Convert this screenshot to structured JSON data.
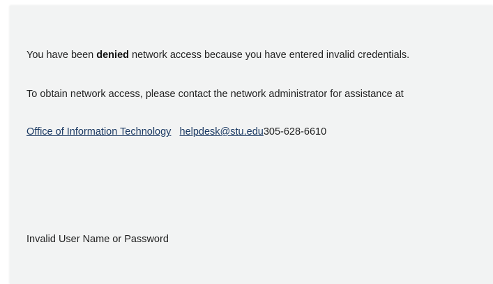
{
  "message": {
    "line1_before": "You have been ",
    "line1_bold": "denied",
    "line1_after": " network access because you have entered invalid credentials.",
    "line2": "To obtain network access, please contact the network administrator for assistance at",
    "contact": {
      "office_link": "Office of Information Technology",
      "email_link": "helpdesk@stu.edu",
      "phone": "305-628-6610"
    },
    "error": "Invalid User Name or Password"
  },
  "colors": {
    "panel_background": "#f2f3f3",
    "link": "#1c3a63",
    "text": "#222222"
  }
}
